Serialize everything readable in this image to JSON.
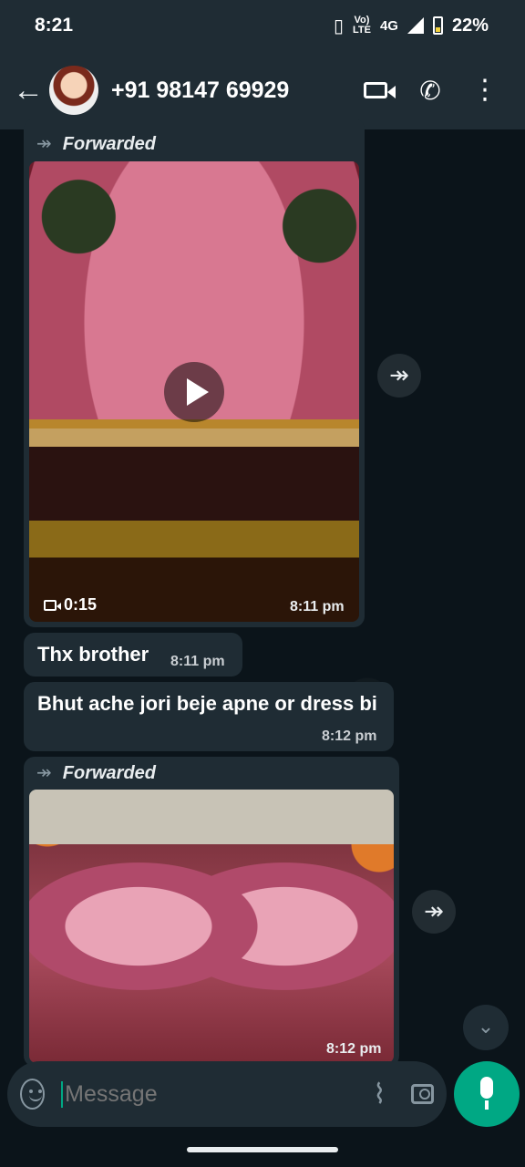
{
  "status_bar": {
    "time": "8:21",
    "network": "4G",
    "lte_top": "Vo)",
    "lte_bottom": "LTE",
    "battery": "22%"
  },
  "header": {
    "contact": "+91 98147 69929"
  },
  "messages": [
    {
      "type": "video",
      "forwarded_label": "Forwarded",
      "duration": "0:15",
      "time": "8:11 pm"
    },
    {
      "type": "text",
      "text": "Thx brother",
      "time": "8:11 pm"
    },
    {
      "type": "text",
      "text": "Bhut ache jori beje apne or dress bi",
      "time": "8:12 pm"
    },
    {
      "type": "image",
      "forwarded_label": "Forwarded",
      "time": "8:12 pm"
    }
  ],
  "composer": {
    "placeholder": "Message"
  },
  "colors": {
    "accent": "#00a884",
    "bubble": "#1f2c34",
    "background": "#0b141a"
  }
}
